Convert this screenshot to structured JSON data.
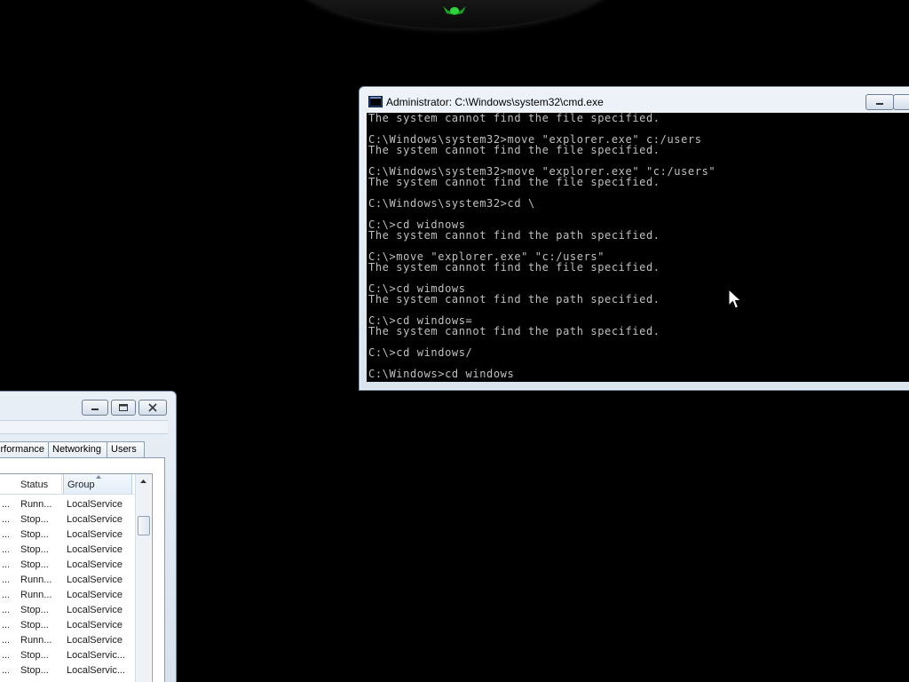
{
  "cmd": {
    "title": "Administrator: C:\\Windows\\system32\\cmd.exe",
    "lines": [
      "The system cannot find the file specified.",
      "",
      "C:\\Windows\\system32>move \"explorer.exe\" c:/users",
      "The system cannot find the file specified.",
      "",
      "C:\\Windows\\system32>move \"explorer.exe\" \"c:/users\"",
      "The system cannot find the file specified.",
      "",
      "C:\\Windows\\system32>cd \\",
      "",
      "C:\\>cd widnows",
      "The system cannot find the path specified.",
      "",
      "C:\\>move \"explorer.exe\" \"c:/users\"",
      "The system cannot find the file specified.",
      "",
      "C:\\>cd wimdows",
      "The system cannot find the path specified.",
      "",
      "C:\\>cd windows=",
      "The system cannot find the path specified.",
      "",
      "C:\\>cd windows/",
      "",
      "C:\\Windows>cd windows"
    ]
  },
  "taskmanager": {
    "tabs": {
      "performance": "rformance",
      "networking": "Networking",
      "users": "Users"
    },
    "columns": {
      "status": "Status",
      "group": "Group"
    },
    "rows": [
      {
        "dots": "...",
        "status": "Runn...",
        "group": "LocalService"
      },
      {
        "dots": "...",
        "status": "Stop...",
        "group": "LocalService"
      },
      {
        "dots": "...",
        "status": "Stop...",
        "group": "LocalService"
      },
      {
        "dots": "...",
        "status": "Stop...",
        "group": "LocalService"
      },
      {
        "dots": "...",
        "status": "Stop...",
        "group": "LocalService"
      },
      {
        "dots": "...",
        "status": "Runn...",
        "group": "LocalService"
      },
      {
        "dots": "...",
        "status": "Runn...",
        "group": "LocalService"
      },
      {
        "dots": "...",
        "status": "Stop...",
        "group": "LocalService"
      },
      {
        "dots": "...",
        "status": "Stop...",
        "group": "LocalService"
      },
      {
        "dots": "...",
        "status": "Runn...",
        "group": "LocalService"
      },
      {
        "dots": "...",
        "status": "Stop...",
        "group": "LocalServic..."
      },
      {
        "dots": "...",
        "status": "Stop...",
        "group": "LocalServic..."
      },
      {
        "dots": "",
        "status": "",
        "group": ""
      }
    ]
  },
  "colors": {
    "console_text": "#c0c0c0",
    "console_bg": "#000000",
    "desktop_bg": "#000000",
    "led": "#1fbf2a"
  }
}
